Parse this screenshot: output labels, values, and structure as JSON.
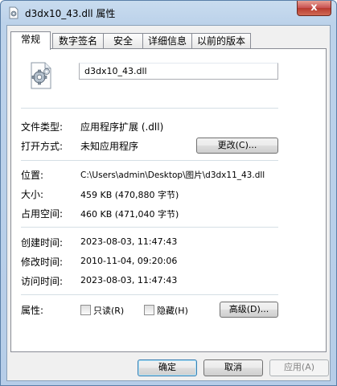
{
  "window": {
    "title": "d3dx10_43.dll 属性",
    "close_glyph": "x"
  },
  "tabs": [
    {
      "label": "常规",
      "active": true
    },
    {
      "label": "数字签名",
      "active": false
    },
    {
      "label": "安全",
      "active": false
    },
    {
      "label": "详细信息",
      "active": false
    },
    {
      "label": "以前的版本",
      "active": false
    }
  ],
  "general": {
    "file_name": "d3dx10_43.dll",
    "file_type_label": "文件类型:",
    "file_type_value": "应用程序扩展 (.dll)",
    "opens_with_label": "打开方式:",
    "opens_with_value": "未知应用程序",
    "change_button": "更改(C)...",
    "location_label": "位置:",
    "location_value": "C:\\Users\\admin\\Desktop\\图片\\d3dx11_43.dll",
    "size_label": "大小:",
    "size_value": "459 KB (470,880 字节)",
    "size_on_disk_label": "占用空间:",
    "size_on_disk_value": "460 KB (471,040 字节)",
    "created_label": "创建时间:",
    "created_value": "2023-08-03, 11:47:43",
    "modified_label": "修改时间:",
    "modified_value": "2010-11-04, 09:20:06",
    "accessed_label": "访问时间:",
    "accessed_value": "2023-08-03, 11:47:43",
    "attributes_label": "属性:",
    "readonly_label": "只读(R)",
    "hidden_label": "隐藏(H)",
    "advanced_button": "高级(D)..."
  },
  "footer": {
    "ok": "确定",
    "cancel": "取消",
    "apply": "应用(A)"
  },
  "colors": {
    "accent_border": "#3c7fb1",
    "close_red": "#c75050"
  }
}
